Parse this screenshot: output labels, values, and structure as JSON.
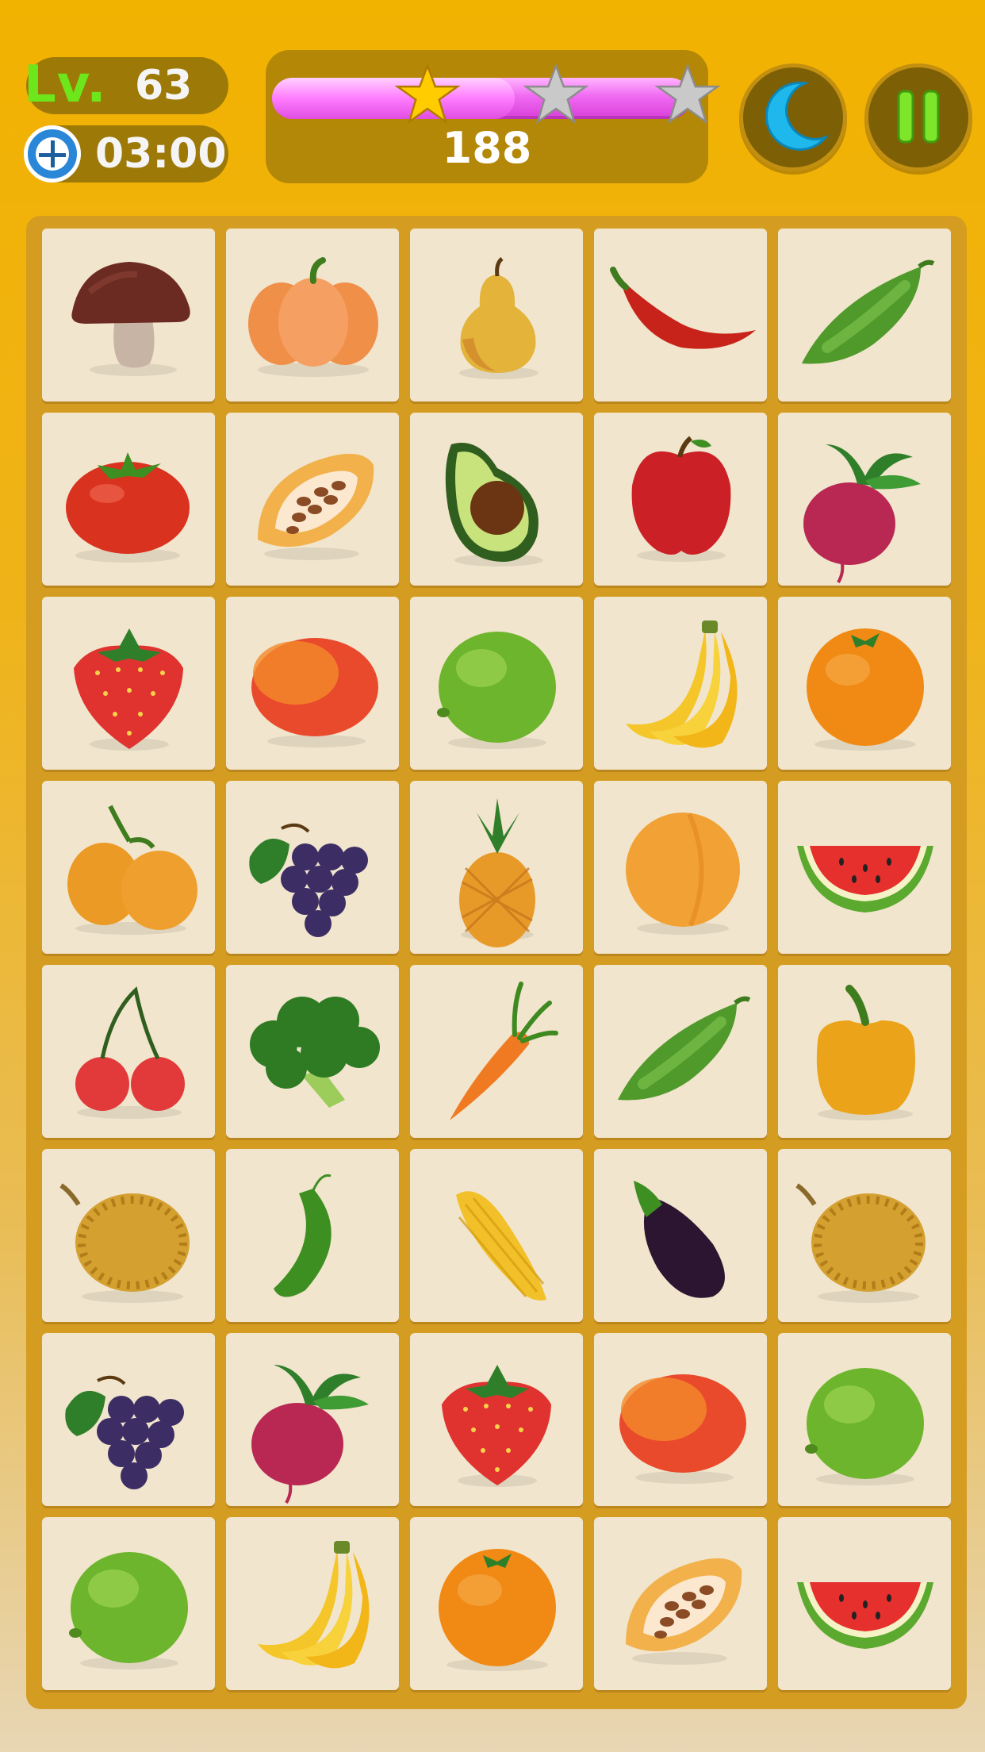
{
  "hud": {
    "level_prefix": "Lv.",
    "level_value": "63",
    "timer": "03:00",
    "score": "188",
    "progress_fraction": 0.58,
    "stars": [
      {
        "state": "earned",
        "color": "#ffcc00"
      },
      {
        "state": "empty",
        "color": "#c9c9c9"
      },
      {
        "state": "empty",
        "color": "#c9c9c9"
      }
    ]
  },
  "buttons": {
    "moon_icon": "moon-icon",
    "pause_icon": "pause-icon"
  },
  "board": {
    "rows": 8,
    "cols": 5,
    "tiles": [
      [
        "mushroom",
        "pumpkin",
        "pear",
        "chili-pepper",
        "pea-pod"
      ],
      [
        "tomato",
        "cocoa-pod",
        "avocado",
        "apple",
        "radish"
      ],
      [
        "strawberry",
        "mango",
        "lime",
        "banana",
        "orange"
      ],
      [
        "apricots",
        "grapes",
        "pineapple",
        "peach",
        "watermelon"
      ],
      [
        "cherries",
        "broccoli",
        "carrot",
        "pea-pod",
        "bell-pepper"
      ],
      [
        "durian",
        "cucumber",
        "corn",
        "eggplant",
        "durian"
      ],
      [
        "grapes",
        "radish",
        "strawberry",
        "mango",
        "lime"
      ],
      [
        "lime",
        "banana",
        "orange",
        "cocoa-pod",
        "watermelon"
      ]
    ]
  },
  "colors": {
    "background": "#f2b200",
    "board": "#d49c20",
    "tile": "#f1e5cd",
    "level_green": "#6ee61c",
    "bar_pink": "#f06af2"
  }
}
